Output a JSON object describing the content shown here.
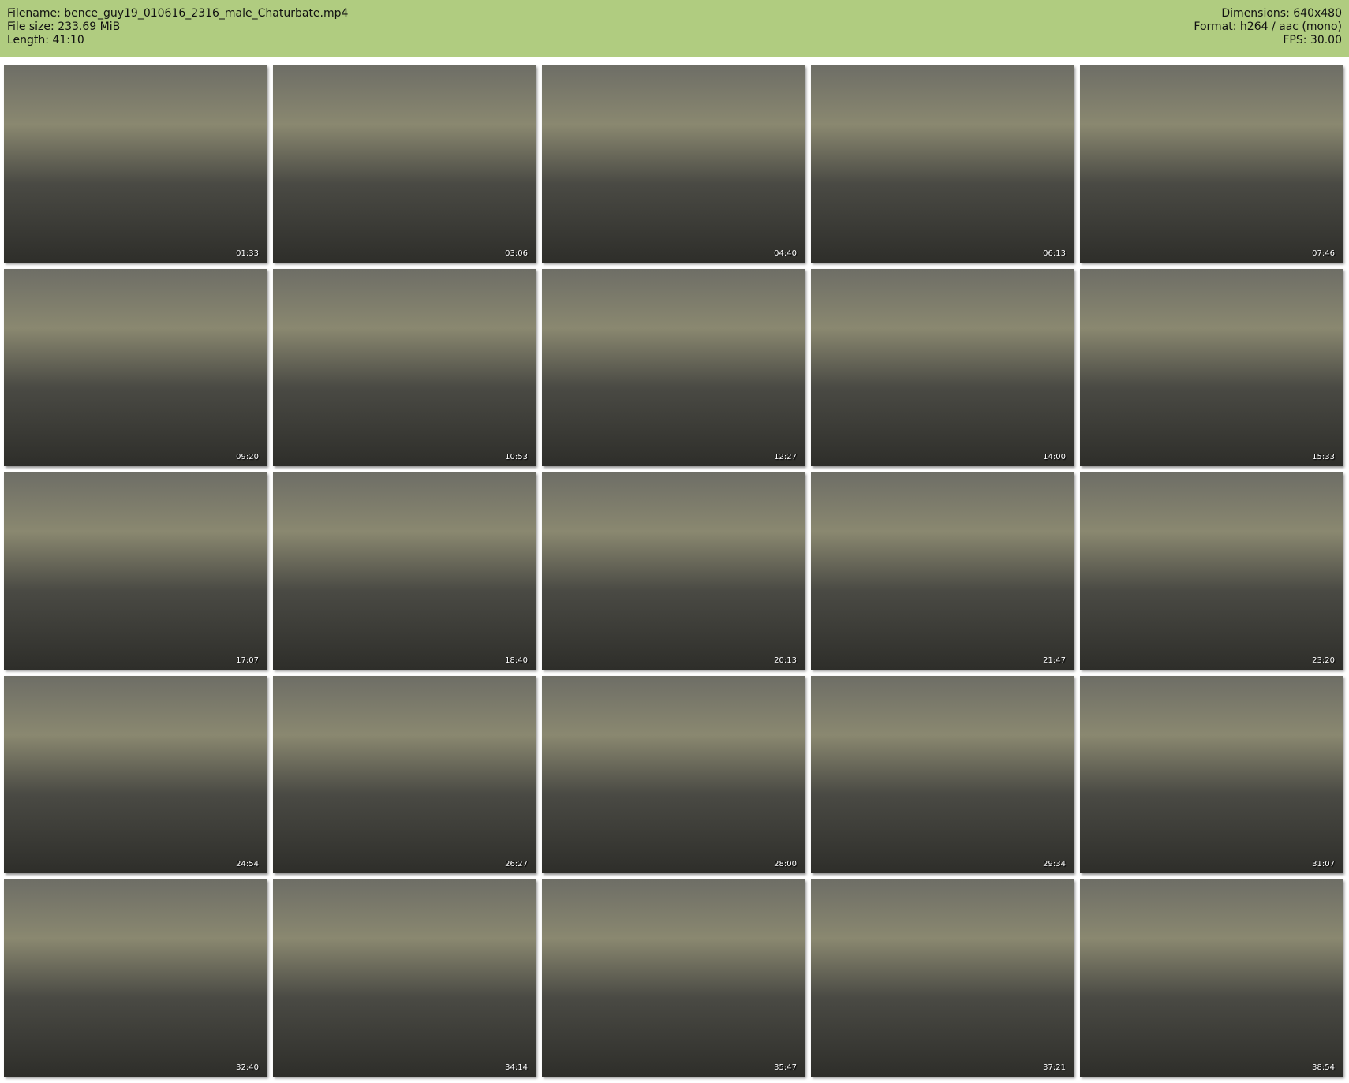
{
  "header": {
    "filename": "Filename: bence_guy19_010616_2316_male_Chaturbate.mp4",
    "filesize": "File size: 233.69 MiB",
    "length": "Length: 41:10",
    "dimensions": "Dimensions: 640x480",
    "format": "Format: h264 / aac (mono)",
    "fps": "FPS: 30.00"
  },
  "thumbnails": [
    {
      "time": "01:33"
    },
    {
      "time": "03:06"
    },
    {
      "time": "04:40"
    },
    {
      "time": "06:13"
    },
    {
      "time": "07:46"
    },
    {
      "time": "09:20"
    },
    {
      "time": "10:53"
    },
    {
      "time": "12:27"
    },
    {
      "time": "14:00"
    },
    {
      "time": "15:33"
    },
    {
      "time": "17:07"
    },
    {
      "time": "18:40"
    },
    {
      "time": "20:13"
    },
    {
      "time": "21:47"
    },
    {
      "time": "23:20"
    },
    {
      "time": "24:54"
    },
    {
      "time": "26:27"
    },
    {
      "time": "28:00"
    },
    {
      "time": "29:34"
    },
    {
      "time": "31:07"
    },
    {
      "time": "32:40"
    },
    {
      "time": "34:14"
    },
    {
      "time": "35:47"
    },
    {
      "time": "37:21"
    },
    {
      "time": "38:54"
    }
  ]
}
